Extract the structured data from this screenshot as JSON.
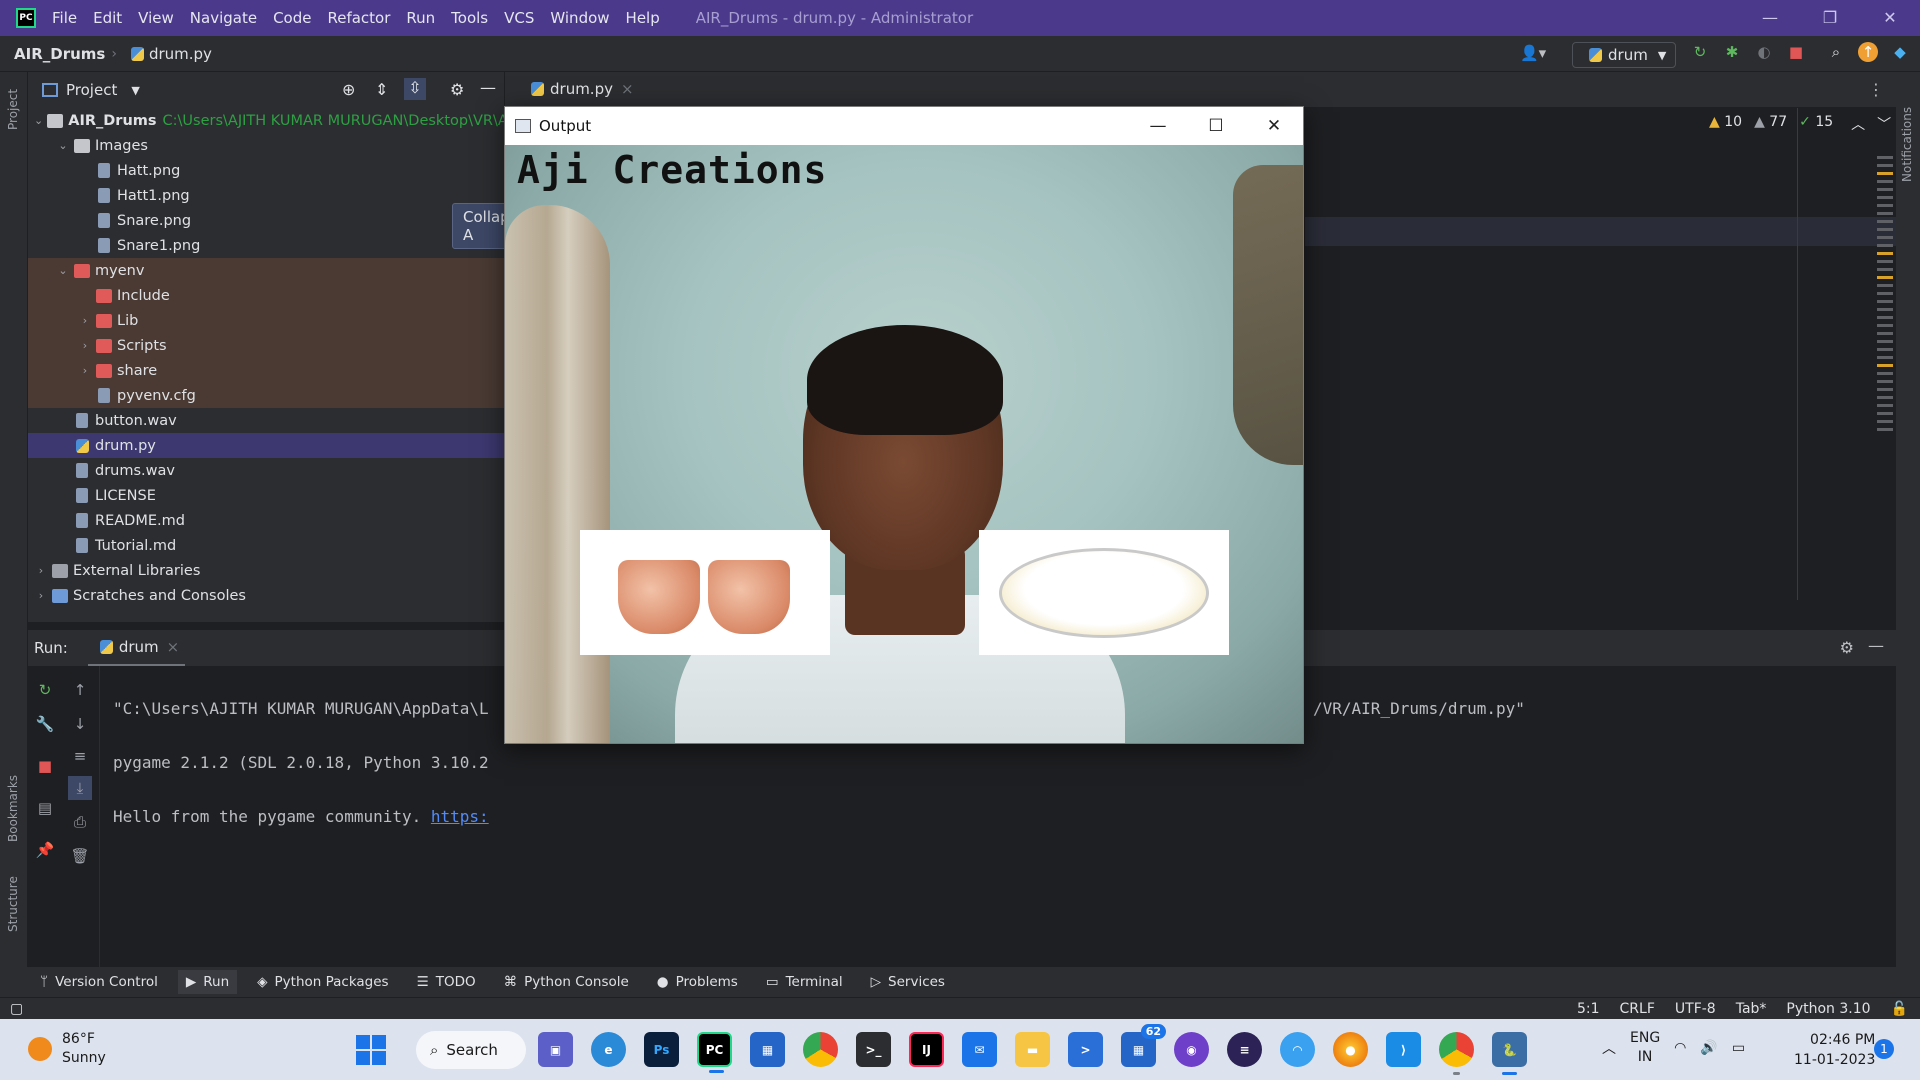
{
  "ide": {
    "title_menu": [
      "File",
      "Edit",
      "View",
      "Navigate",
      "Code",
      "Refactor",
      "Run",
      "Tools",
      "VCS",
      "Window",
      "Help"
    ],
    "window_title": "AIR_Drums - drum.py - Administrator",
    "project_name": "AIR_Drums",
    "breadcrumb_file": "drum.py",
    "run_config": "drum",
    "window_controls": {
      "minimize": "—",
      "restore": "❐",
      "close": "✕"
    }
  },
  "project_panel": {
    "title": "Project",
    "tooltip": "Collapse A",
    "root": {
      "name": "AIR_Drums",
      "path": "C:\\Users\\AJITH KUMAR MURUGAN\\Desktop\\VR\\AIR"
    },
    "items": [
      {
        "label": "Images",
        "type": "folder",
        "indent": 1,
        "expanded": true
      },
      {
        "label": "Hatt.png",
        "type": "file",
        "indent": 2
      },
      {
        "label": "Hatt1.png",
        "type": "file",
        "indent": 2
      },
      {
        "label": "Snare.png",
        "type": "file",
        "indent": 2
      },
      {
        "label": "Snare1.png",
        "type": "file",
        "indent": 2
      },
      {
        "label": "myenv",
        "type": "folder-env",
        "indent": 1,
        "expanded": true
      },
      {
        "label": "Include",
        "type": "folder-env-child",
        "indent": 2
      },
      {
        "label": "Lib",
        "type": "folder-env-child",
        "indent": 2,
        "collapsed": true
      },
      {
        "label": "Scripts",
        "type": "folder-env-child",
        "indent": 2,
        "collapsed": true
      },
      {
        "label": "share",
        "type": "folder-env-child",
        "indent": 2,
        "collapsed": true
      },
      {
        "label": "pyvenv.cfg",
        "type": "file-env",
        "indent": 2
      },
      {
        "label": "button.wav",
        "type": "file",
        "indent": 1
      },
      {
        "label": "drum.py",
        "type": "python",
        "indent": 1,
        "selected": true
      },
      {
        "label": "drums.wav",
        "type": "file",
        "indent": 1
      },
      {
        "label": "LICENSE",
        "type": "file",
        "indent": 1
      },
      {
        "label": "README.md",
        "type": "file",
        "indent": 1
      },
      {
        "label": "Tutorial.md",
        "type": "file",
        "indent": 1
      },
      {
        "label": "External Libraries",
        "type": "lib",
        "indent": 0,
        "collapsed": true
      },
      {
        "label": "Scratches and Consoles",
        "type": "scratch",
        "indent": 0,
        "collapsed": true
      }
    ]
  },
  "editor": {
    "tab": "drum.py",
    "inspections": {
      "warnings_a": "10",
      "warnings_b": "77",
      "ok": "15"
    }
  },
  "run_panel": {
    "label": "Run:",
    "tab": "drum",
    "console_lines": [
      {
        "text": "\"C:\\Users\\AJITH KUMAR MURUGAN\\AppData\\L",
        "tail": "/VR/AIR_Drums/drum.py\""
      },
      {
        "text": "pygame 2.1.2 (SDL 2.0.18, Python 3.10.2"
      },
      {
        "text": "Hello from the pygame community. ",
        "link": "https:"
      }
    ]
  },
  "output_window": {
    "title": "Output",
    "overlay_text": "Aji Creations"
  },
  "bottom_tools": [
    "Version Control",
    "Run",
    "Python Packages",
    "TODO",
    "Python Console",
    "Problems",
    "Terminal",
    "Services"
  ],
  "side_labels": {
    "project": "Project",
    "bookmarks": "Bookmarks",
    "structure": "Structure",
    "notifications": "Notifications"
  },
  "status_bar": [
    "5:1",
    "CRLF",
    "UTF-8",
    "Tab*",
    "Python 3.10"
  ],
  "taskbar": {
    "weather_temp": "86°F",
    "weather_desc": "Sunny",
    "search_label": "Search",
    "store_badge": "62",
    "lang_top": "ENG",
    "lang_bottom": "IN",
    "time": "02:46 PM",
    "date": "11-01-2023",
    "notification_count": "1"
  }
}
